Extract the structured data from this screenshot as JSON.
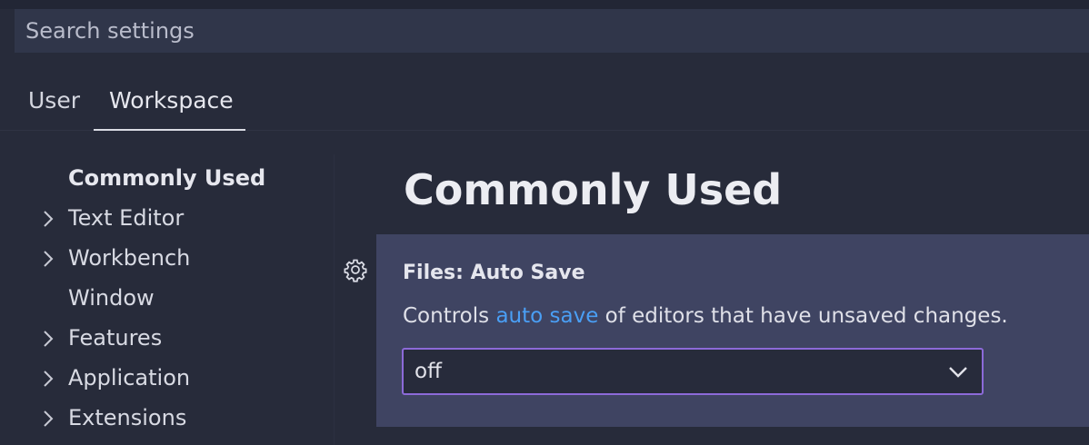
{
  "search": {
    "placeholder": "Search settings"
  },
  "tabs": [
    {
      "label": "User",
      "active": false
    },
    {
      "label": "Workspace",
      "active": true
    }
  ],
  "toc": {
    "items": [
      {
        "label": "Commonly Used",
        "expandable": false,
        "active": true
      },
      {
        "label": "Text Editor",
        "expandable": true,
        "active": false
      },
      {
        "label": "Workbench",
        "expandable": true,
        "active": false
      },
      {
        "label": "Window",
        "expandable": false,
        "active": false
      },
      {
        "label": "Features",
        "expandable": true,
        "active": false
      },
      {
        "label": "Application",
        "expandable": true,
        "active": false
      },
      {
        "label": "Extensions",
        "expandable": true,
        "active": false
      }
    ]
  },
  "content": {
    "section_title": "Commonly Used"
  },
  "setting": {
    "icon": "gear-icon",
    "title": "Files: Auto Save",
    "description_prefix": "Controls ",
    "description_link": "auto save",
    "description_suffix": " of editors that have unsaved changes.",
    "selected_value": "off",
    "dropdown_icon": "chevron-down-icon"
  },
  "colors": {
    "background": "#272b3a",
    "card": "#3f4462",
    "link": "#4a9ff5",
    "focus_border": "#8c6ad8"
  }
}
